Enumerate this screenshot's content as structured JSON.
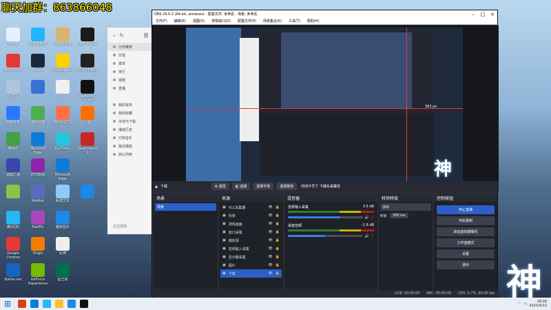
{
  "banner": "聊天加群：863866048",
  "desktop": {
    "icons": [
      {
        "label": "此电脑",
        "color": "#e6f0ff"
      },
      {
        "label": "雷神加速器",
        "color": "#1fb5ff"
      },
      {
        "label": "原神启动器",
        "color": "#d9b66b"
      },
      {
        "label": "OBS Studio",
        "color": "#1a1a1a"
      },
      {
        "label": "WPS Office",
        "color": "#e53935"
      },
      {
        "label": "Steam",
        "color": "#1b2838"
      },
      {
        "label": "Borderlands 3",
        "color": "#ffcf00"
      },
      {
        "label": "OUTRIDERS",
        "color": "#222"
      },
      {
        "label": "回收站",
        "color": "#b0c4de"
      },
      {
        "label": "",
        "color": "#3a6fd8"
      },
      {
        "label": "log",
        "color": "#f0f0f0"
      },
      {
        "label": "Logitech G HUB",
        "color": "#111"
      },
      {
        "label": "电脑管家",
        "color": "#2979ff"
      },
      {
        "label": "游戏加速",
        "color": "#4caf50"
      },
      {
        "label": "OBS录屏工具",
        "color": "#ff7043"
      },
      {
        "label": "斗鱼",
        "color": "#ff6f00"
      },
      {
        "label": "英伟达",
        "color": "#43a047"
      },
      {
        "label": "Microsoft Edge",
        "color": "#0f7bd6"
      },
      {
        "label": "FunTimer",
        "color": "#26c6da"
      },
      {
        "label": "Dead Island 2",
        "color": "#c62828"
      },
      {
        "label": "盗贼之海",
        "color": "#3949ab"
      },
      {
        "label": "DTOBSR",
        "color": "#8e24aa"
      },
      {
        "label": "Microsoft Edge",
        "color": "#0f7bd6"
      },
      {
        "label": "",
        "color": "transparent"
      },
      {
        "label": "",
        "color": "#8bc34a"
      },
      {
        "label": "WeMod",
        "color": "#5c6bc0"
      },
      {
        "label": "新建文本",
        "color": "#90caf9"
      },
      {
        "label": "",
        "color": "#1e88e5"
      },
      {
        "label": "腾讯QQ",
        "color": "#29b6f6"
      },
      {
        "label": "FastPic",
        "color": "#ab47bc"
      },
      {
        "label": "酷狗音乐",
        "color": "#1e88e5"
      },
      {
        "label": "",
        "color": "transparent"
      },
      {
        "label": "Google Chrome",
        "color": "#e53935"
      },
      {
        "label": "Origin",
        "color": "#f57c00"
      },
      {
        "label": "原神",
        "color": "#eeeeee"
      },
      {
        "label": "",
        "color": "transparent"
      },
      {
        "label": "Battle.net",
        "color": "#1565c0"
      },
      {
        "label": "GeForce Experience",
        "color": "#76b900"
      },
      {
        "label": "星巴克",
        "color": "#00704a"
      },
      {
        "label": "",
        "color": "transparent"
      }
    ]
  },
  "music": {
    "title": "音",
    "items": [
      "为你推荐",
      "乐馆",
      "歌单",
      "排行",
      "视频",
      "直播",
      "",
      "我的喜欢",
      "我的收藏",
      "本地与下载",
      "播放历史",
      "已购音乐",
      "最近播放",
      "默认列表"
    ],
    "login": "正在连接..."
  },
  "obs": {
    "title": "OBS 29.0.2 (64-bit, windows) - 配置文件: 未命名 - 场景: 未命名",
    "menu": [
      "文件(F)",
      "编辑(E)",
      "视图(V)",
      "停靠窗口(D)",
      "配置文件(P)",
      "场景集合(S)",
      "工具(T)",
      "帮助(H)"
    ],
    "context": {
      "source": "下载",
      "properties": "属性",
      "filters": "滤镜",
      "btns": [
        "选择字体",
        "选择颜色"
      ],
      "text": "时间不早了 下播先来睡觉"
    },
    "scenes": {
      "title": "场景",
      "items": [
        "场景"
      ]
    },
    "sources": {
      "title": "来源",
      "items": [
        "VLC采集器",
        "背景",
        "游戏画面",
        "窗口采集",
        "媒体源",
        "音频输入采集",
        "显示器采集",
        "图片",
        "下载"
      ],
      "selected": 8
    },
    "mixer": {
      "title": "混音器",
      "rows": [
        {
          "name": "音频输入采集",
          "db": "3.5 dB",
          "level": 0.7
        },
        {
          "name": "桌面音频",
          "db": "-1.6 dB",
          "level": 0.5
        }
      ]
    },
    "transitions": {
      "title": "转场特效",
      "type": "淡出",
      "duration_label": "时长",
      "duration": "300 ms"
    },
    "controls": {
      "title": "控制按钮",
      "buttons": [
        "停止直播",
        "开始录制",
        "启动虚拟摄像机",
        "工作室模式",
        "设置",
        "退出"
      ]
    },
    "status": {
      "live": "LIVE: 00:00:00",
      "rec": "REC: 00:00:00",
      "cpu": "CPU: 0.7%, 60.00 fps"
    }
  },
  "overlay": {
    "genshin_logo": "神",
    "dimension": "363 px"
  },
  "taskbar": {
    "time": "18:28",
    "date": "2023/4/22"
  }
}
